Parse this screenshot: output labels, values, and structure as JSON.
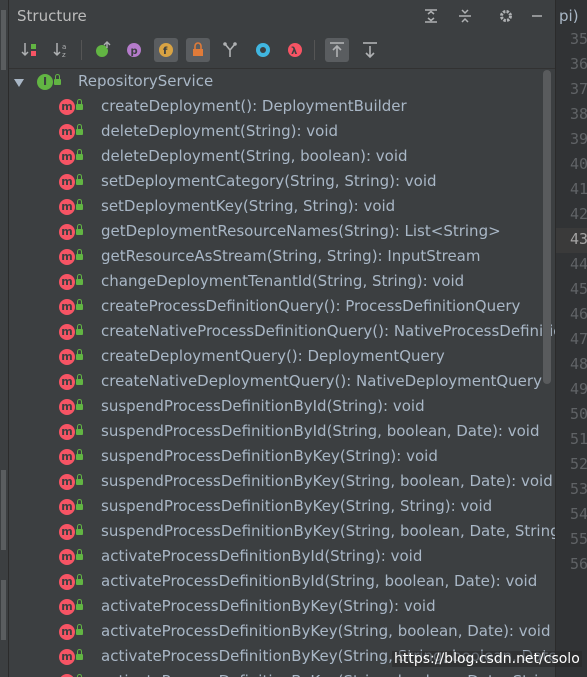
{
  "panel_title": "Structure",
  "gutter_tab_label": "pi)",
  "root": {
    "label": "RepositoryService"
  },
  "methods": [
    "createDeployment(): DeploymentBuilder",
    "deleteDeployment(String): void",
    "deleteDeployment(String, boolean): void",
    "setDeploymentCategory(String, String): void",
    "setDeploymentKey(String, String): void",
    "getDeploymentResourceNames(String): List<String>",
    "getResourceAsStream(String, String): InputStream",
    "changeDeploymentTenantId(String, String): void",
    "createProcessDefinitionQuery(): ProcessDefinitionQuery",
    "createNativeProcessDefinitionQuery(): NativeProcessDefinition",
    "createDeploymentQuery(): DeploymentQuery",
    "createNativeDeploymentQuery(): NativeDeploymentQuery",
    "suspendProcessDefinitionById(String): void",
    "suspendProcessDefinitionById(String, boolean, Date): void",
    "suspendProcessDefinitionByKey(String): void",
    "suspendProcessDefinitionByKey(String, boolean, Date): void",
    "suspendProcessDefinitionByKey(String, String): void",
    "suspendProcessDefinitionByKey(String, boolean, Date, String):",
    "activateProcessDefinitionById(String): void",
    "activateProcessDefinitionById(String, boolean, Date): void",
    "activateProcessDefinitionByKey(String): void",
    "activateProcessDefinitionByKey(String, boolean, Date): void",
    "activateProcessDefinitionByKey(String, String, boolean, Date): void",
    "activateProcessDefinitionByKey(String, boolean, Date, String)"
  ],
  "line_numbers": [
    "35",
    "36",
    "37",
    "38",
    "39",
    "40",
    "41",
    "42",
    "43",
    "44",
    "45",
    "46",
    "47",
    "48",
    "49",
    "50",
    "51",
    "52",
    "53",
    "54",
    "55",
    "56"
  ],
  "current_line": "43",
  "watermark": "https://blog.csdn.net/csolo",
  "colors": {
    "method_icon": "#f75464",
    "lock": "#62b543",
    "text": "#a9b7c6",
    "panel_bg": "#3c3f41"
  }
}
